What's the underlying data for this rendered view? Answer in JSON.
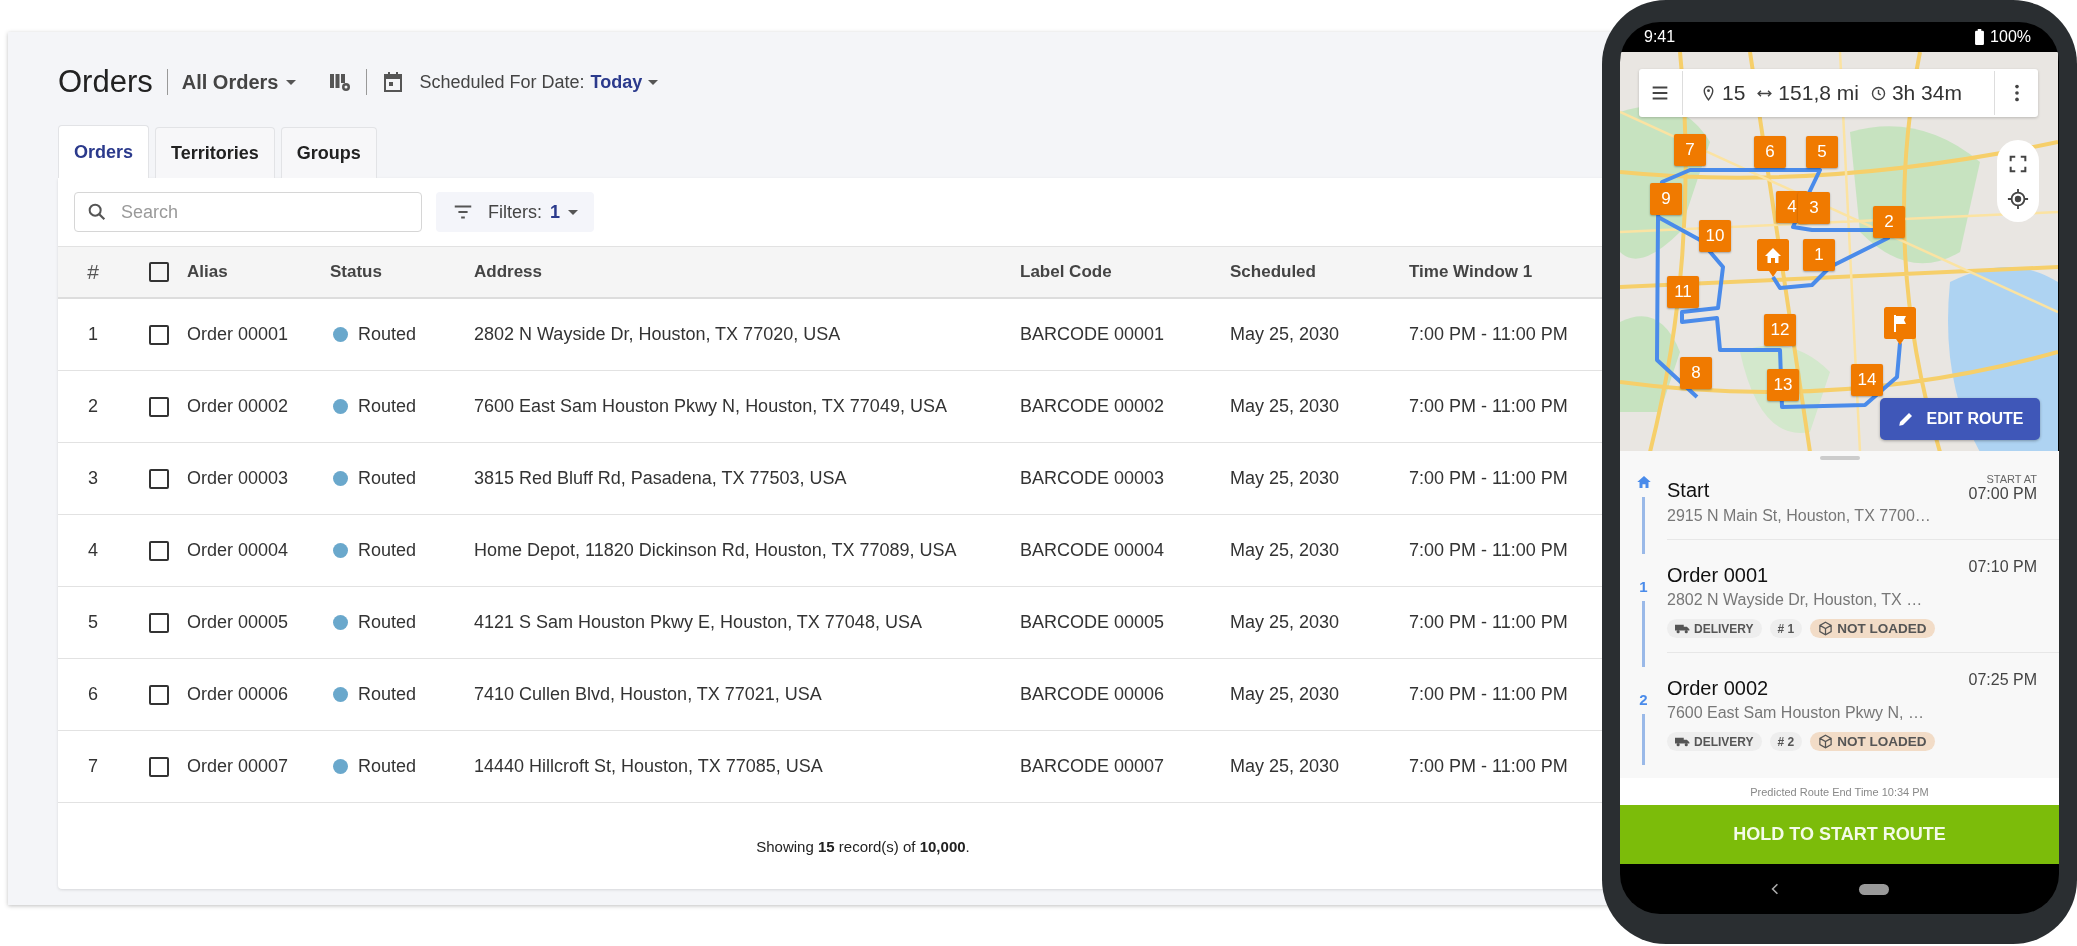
{
  "header": {
    "title": "Orders",
    "view": "All Orders",
    "date_label": "Scheduled For Date:",
    "date_value": "Today"
  },
  "tabs": [
    {
      "label": "Orders",
      "selected": true
    },
    {
      "label": "Territories",
      "selected": false
    },
    {
      "label": "Groups",
      "selected": false
    }
  ],
  "search": {
    "placeholder": "Search"
  },
  "filters": {
    "label": "Filters:",
    "count": "1"
  },
  "table": {
    "header_checked": false,
    "columns": [
      "#",
      "Alias",
      "Status",
      "Address",
      "Label Code",
      "Scheduled",
      "Time Window 1"
    ],
    "rows": [
      {
        "number": "1",
        "checked": false,
        "alias": "Order 00001",
        "status": "Routed",
        "address": "2802 N Wayside Dr, Houston, TX 77020, USA",
        "label_code": "BARCODE 00001",
        "scheduled": "May 25, 2030",
        "time_window": "7:00 PM - 11:00 PM"
      },
      {
        "number": "2",
        "checked": false,
        "alias": "Order 00002",
        "status": "Routed",
        "address": "7600 East Sam Houston Pkwy N, Houston, TX 77049, USA",
        "label_code": "BARCODE 00002",
        "scheduled": "May 25, 2030",
        "time_window": "7:00 PM - 11:00 PM"
      },
      {
        "number": "3",
        "checked": false,
        "alias": "Order 00003",
        "status": "Routed",
        "address": "3815 Red Bluff Rd, Pasadena, TX 77503, USA",
        "label_code": "BARCODE 00003",
        "scheduled": "May 25, 2030",
        "time_window": "7:00 PM - 11:00 PM"
      },
      {
        "number": "4",
        "checked": false,
        "alias": "Order 00004",
        "status": "Routed",
        "address": "Home Depot, 11820 Dickinson Rd, Houston, TX 77089, USA",
        "label_code": "BARCODE 00004",
        "scheduled": "May 25, 2030",
        "time_window": "7:00 PM - 11:00 PM"
      },
      {
        "number": "5",
        "checked": false,
        "alias": "Order 00005",
        "status": "Routed",
        "address": "4121 S Sam Houston Pkwy E, Houston, TX 77048, USA",
        "label_code": "BARCODE 00005",
        "scheduled": "May 25, 2030",
        "time_window": "7:00 PM - 11:00 PM"
      },
      {
        "number": "6",
        "checked": false,
        "alias": "Order 00006",
        "status": "Routed",
        "address": "7410 Cullen Blvd, Houston, TX 77021, USA",
        "label_code": "BARCODE 00006",
        "scheduled": "May 25, 2030",
        "time_window": "7:00 PM - 11:00 PM"
      },
      {
        "number": "7",
        "checked": false,
        "alias": "Order 00007",
        "status": "Routed",
        "address": "14440 Hillcroft St, Houston, TX 77085, USA",
        "label_code": "BARCODE 00007",
        "scheduled": "May 25, 2030",
        "time_window": "7:00 PM - 11:00 PM"
      }
    ],
    "footer": "Showing **15** record(s) of **10,000**."
  },
  "phone": {
    "status_bar": {
      "time": "9:41",
      "battery": "100%"
    },
    "map": {
      "kind": "picture",
      "stops": "15",
      "distance": "151,8 mi",
      "duration": "3h 34m",
      "edit_button": "EDIT ROUTE",
      "pins": [
        {
          "kind": "number",
          "label": "7"
        },
        {
          "kind": "number",
          "label": "6"
        },
        {
          "kind": "number",
          "label": "5"
        },
        {
          "kind": "number",
          "label": "9"
        },
        {
          "kind": "number",
          "label": "4"
        },
        {
          "kind": "number",
          "label": "3"
        },
        {
          "kind": "number",
          "label": "2"
        },
        {
          "kind": "number",
          "label": "10"
        },
        {
          "kind": "home"
        },
        {
          "kind": "number",
          "label": "1"
        },
        {
          "kind": "number",
          "label": "11"
        },
        {
          "kind": "finish"
        },
        {
          "kind": "number",
          "label": "12"
        },
        {
          "kind": "number",
          "label": "8"
        },
        {
          "kind": "number",
          "label": "14"
        },
        {
          "kind": "number",
          "label": "13"
        }
      ]
    },
    "route": [
      {
        "kind": "start",
        "title": "Start",
        "address": "2915 N Main St, Houston, TX 7700…",
        "time_label": "START AT",
        "time": "07:00 PM"
      },
      {
        "kind": "order",
        "number": "1",
        "title": "Order 0001",
        "address": "2802 N Wayside Dr, Houston, TX …",
        "time": "07:10 PM",
        "type": "DELIVERY",
        "sequence": "# 1",
        "load_status": "NOT LOADED"
      },
      {
        "kind": "order",
        "number": "2",
        "title": "Order 0002",
        "address": "7600 East Sam Houston Pkwy N, …",
        "time": "07:25 PM",
        "type": "DELIVERY",
        "sequence": "# 2",
        "load_status": "NOT LOADED"
      }
    ],
    "predicted": "Predicted Route End Time 10:34 PM",
    "start_button": "HOLD TO START ROUTE"
  }
}
